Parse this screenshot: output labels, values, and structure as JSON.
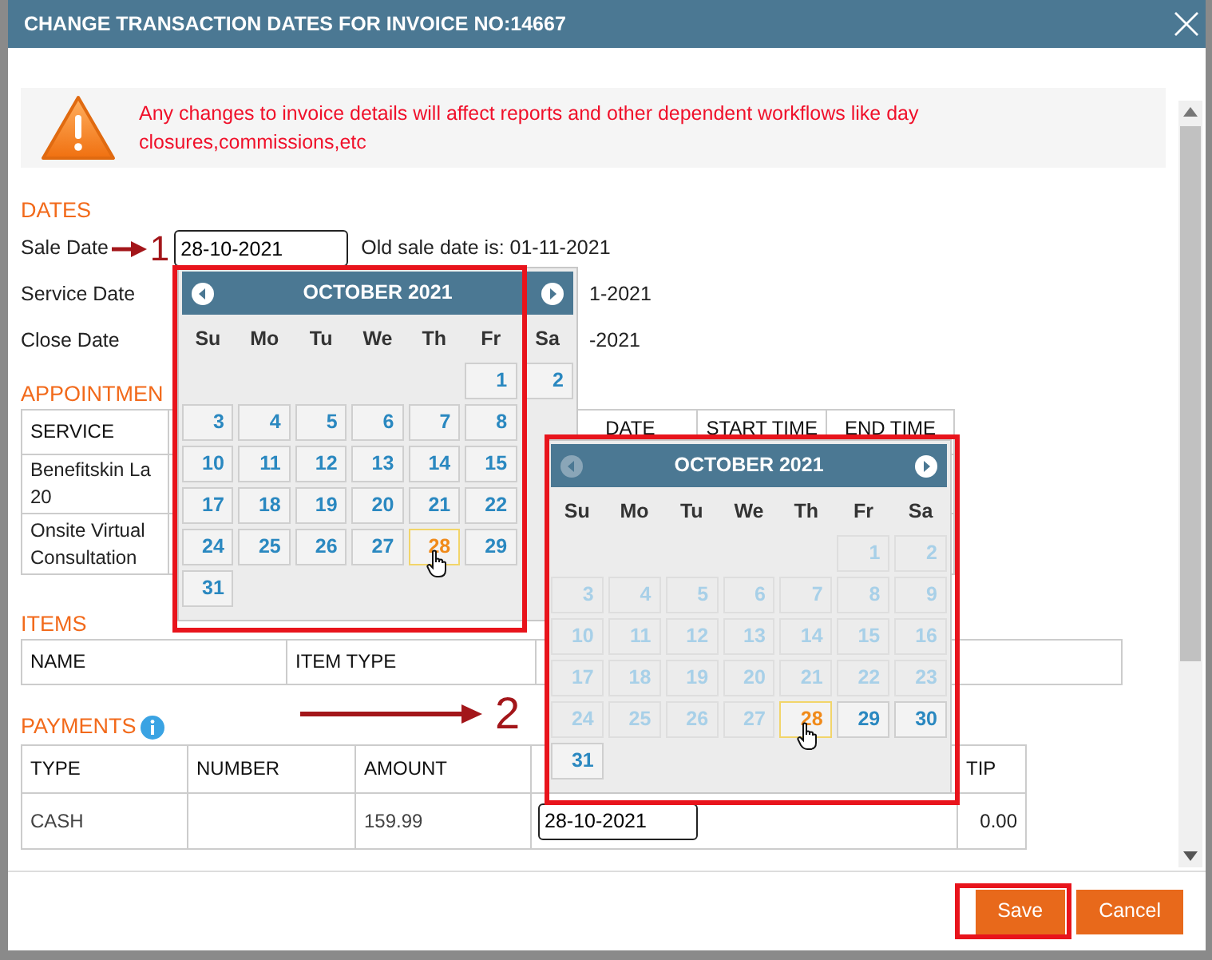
{
  "dialog": {
    "title": "CHANGE TRANSACTION DATES FOR INVOICE NO:14667"
  },
  "warning": "Any changes to invoice details will affect reports and other dependent workflows like day closures,commissions,etc",
  "dates": {
    "heading": "DATES",
    "rows": [
      {
        "kind": "input",
        "label": "Sale Date",
        "value": "28-10-2021",
        "note": "Old sale date is: 01-11-2021",
        "marker": "1"
      },
      {
        "kind": "text",
        "label": "Service Date",
        "note": "1-2021"
      },
      {
        "kind": "text",
        "label": "Close Date",
        "note": "-2021"
      }
    ]
  },
  "appointments": {
    "heading": "APPOINTMEN",
    "columns": [
      "SERVICE",
      "DATE",
      "START TIME",
      "END TIME"
    ],
    "rows": [
      {
        "service": [
          "Benefitskin La",
          "20"
        ]
      },
      {
        "service": [
          "Onsite Virtual",
          "Consultation"
        ]
      }
    ]
  },
  "items": {
    "heading": "ITEMS",
    "columns": [
      "NAME",
      "ITEM TYPE"
    ]
  },
  "payments": {
    "heading": "PAYMENTS",
    "marker": "2",
    "columns": [
      "TYPE",
      "NUMBER",
      "AMOUNT",
      "TIP"
    ],
    "rows": [
      {
        "type": "CASH",
        "amount": "159.99",
        "date": "28-10-2021",
        "tip": "0.00"
      }
    ]
  },
  "calendars": [
    {
      "month": "OCTOBER 2021",
      "prev_disabled": false,
      "weekdays": [
        "Su",
        "Mo",
        "Tu",
        "We",
        "Th",
        "Fr",
        "Sa"
      ],
      "weeks": [
        [
          {
            "day": "1",
            "disabled": false,
            "selected": false
          },
          {
            "day": "2",
            "disabled": false,
            "selected": false
          }
        ],
        [
          {
            "day": "3",
            "disabled": false,
            "selected": false
          },
          {
            "day": "4",
            "disabled": false,
            "selected": false
          },
          {
            "day": "5",
            "disabled": false,
            "selected": false
          },
          {
            "day": "6",
            "disabled": false,
            "selected": false
          },
          {
            "day": "7",
            "disabled": false,
            "selected": false
          },
          {
            "day": "8",
            "disabled": false,
            "selected": false
          }
        ],
        [
          {
            "day": "10",
            "disabled": false,
            "selected": false
          },
          {
            "day": "11",
            "disabled": false,
            "selected": false
          },
          {
            "day": "12",
            "disabled": false,
            "selected": false
          },
          {
            "day": "13",
            "disabled": false,
            "selected": false
          },
          {
            "day": "14",
            "disabled": false,
            "selected": false
          },
          {
            "day": "15",
            "disabled": false,
            "selected": false
          }
        ],
        [
          {
            "day": "17",
            "disabled": false,
            "selected": false
          },
          {
            "day": "18",
            "disabled": false,
            "selected": false
          },
          {
            "day": "19",
            "disabled": false,
            "selected": false
          },
          {
            "day": "20",
            "disabled": false,
            "selected": false
          },
          {
            "day": "21",
            "disabled": false,
            "selected": false
          },
          {
            "day": "22",
            "disabled": false,
            "selected": false
          }
        ],
        [
          {
            "day": "24",
            "disabled": false,
            "selected": false
          },
          {
            "day": "25",
            "disabled": false,
            "selected": false
          },
          {
            "day": "26",
            "disabled": false,
            "selected": false
          },
          {
            "day": "27",
            "disabled": false,
            "selected": false
          },
          {
            "day": "28",
            "disabled": false,
            "selected": true,
            "hovered": true
          },
          {
            "day": "29",
            "disabled": false,
            "selected": false
          }
        ],
        [
          {
            "day": "31",
            "disabled": false,
            "selected": false
          }
        ]
      ]
    },
    {
      "month": "OCTOBER 2021",
      "prev_disabled": true,
      "weekdays": [
        "Su",
        "Mo",
        "Tu",
        "We",
        "Th",
        "Fr",
        "Sa"
      ],
      "weeks": [
        [
          {
            "day": "1",
            "disabled": true,
            "selected": false
          },
          {
            "day": "2",
            "disabled": true,
            "selected": false
          }
        ],
        [
          {
            "day": "3",
            "disabled": true,
            "selected": false
          },
          {
            "day": "4",
            "disabled": true,
            "selected": false
          },
          {
            "day": "5",
            "disabled": true,
            "selected": false
          },
          {
            "day": "6",
            "disabled": true,
            "selected": false
          },
          {
            "day": "7",
            "disabled": true,
            "selected": false
          },
          {
            "day": "8",
            "disabled": true,
            "selected": false
          },
          {
            "day": "9",
            "disabled": true,
            "selected": false
          }
        ],
        [
          {
            "day": "10",
            "disabled": true,
            "selected": false
          },
          {
            "day": "11",
            "disabled": true,
            "selected": false
          },
          {
            "day": "12",
            "disabled": true,
            "selected": false
          },
          {
            "day": "13",
            "disabled": true,
            "selected": false
          },
          {
            "day": "14",
            "disabled": true,
            "selected": false
          },
          {
            "day": "15",
            "disabled": true,
            "selected": false
          },
          {
            "day": "16",
            "disabled": true,
            "selected": false
          }
        ],
        [
          {
            "day": "17",
            "disabled": true,
            "selected": false
          },
          {
            "day": "18",
            "disabled": true,
            "selected": false
          },
          {
            "day": "19",
            "disabled": true,
            "selected": false
          },
          {
            "day": "20",
            "disabled": true,
            "selected": false
          },
          {
            "day": "21",
            "disabled": true,
            "selected": false
          },
          {
            "day": "22",
            "disabled": true,
            "selected": false
          },
          {
            "day": "23",
            "disabled": true,
            "selected": false
          }
        ],
        [
          {
            "day": "24",
            "disabled": true,
            "selected": false
          },
          {
            "day": "25",
            "disabled": true,
            "selected": false
          },
          {
            "day": "26",
            "disabled": true,
            "selected": false
          },
          {
            "day": "27",
            "disabled": true,
            "selected": false
          },
          {
            "day": "28",
            "disabled": false,
            "selected": true,
            "hovered": true
          },
          {
            "day": "29",
            "disabled": false,
            "selected": false
          },
          {
            "day": "30",
            "disabled": false,
            "selected": false
          }
        ],
        [
          {
            "day": "31",
            "disabled": false,
            "selected": false
          }
        ]
      ]
    }
  ],
  "buttons": [
    {
      "label": "Save",
      "highlighted": true
    },
    {
      "label": "Cancel",
      "highlighted": false
    }
  ]
}
